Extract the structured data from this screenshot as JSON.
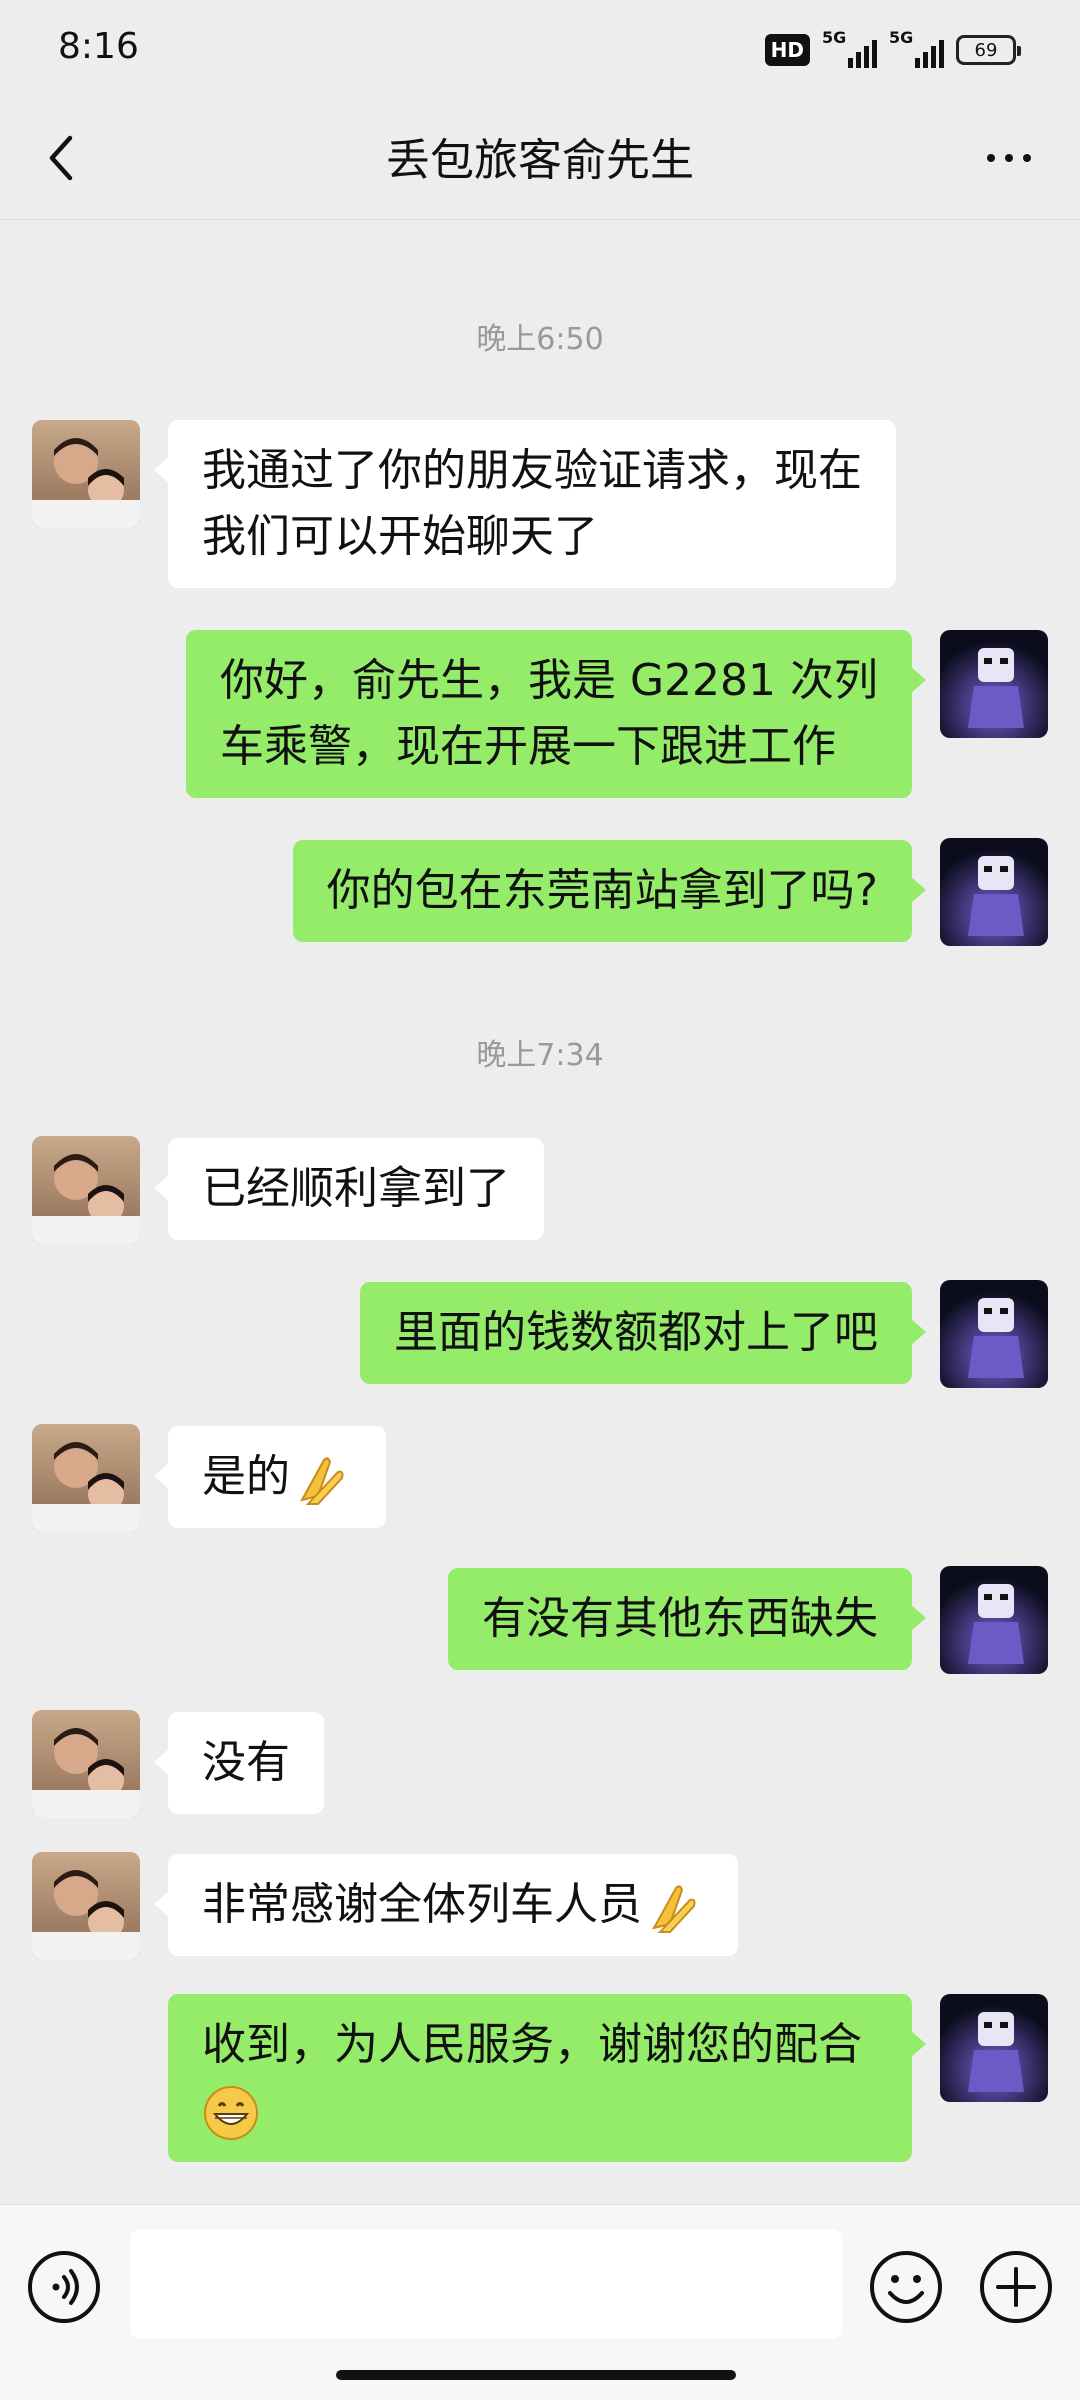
{
  "status_bar": {
    "time": "8:16",
    "hd_badge": "HD",
    "network1": "5G",
    "network2": "5G",
    "battery": "69"
  },
  "header": {
    "title": "丢包旅客俞先生"
  },
  "timestamps": [
    "晚上6:50",
    "晚上7:34"
  ],
  "messages": [
    {
      "side": "recv",
      "lines": [
        "我通过了你的朋友验证请求，现在",
        "我们可以开始聊天了"
      ]
    },
    {
      "side": "sent",
      "lines": [
        "你好，俞先生，我是 G2281 次列",
        "车乘警，现在开展一下跟进工作"
      ]
    },
    {
      "side": "sent",
      "lines": [
        "你的包在东莞南站拿到了吗?"
      ]
    },
    {
      "side": "recv",
      "lines": [
        "已经顺利拿到了"
      ]
    },
    {
      "side": "sent",
      "lines": [
        "里面的钱数额都对上了吧"
      ]
    },
    {
      "side": "recv",
      "lines": [
        "是的"
      ],
      "emoji": "pray-emoji"
    },
    {
      "side": "sent",
      "lines": [
        "有没有其他东西缺失"
      ]
    },
    {
      "side": "recv",
      "lines": [
        "没有"
      ]
    },
    {
      "side": "recv",
      "lines": [
        "非常感谢全体列车人员"
      ],
      "emoji": "pray-emoji"
    },
    {
      "side": "sent",
      "lines": [
        "收到，为人民服务，谢谢您的配合"
      ],
      "emoji": "grin-emoji"
    }
  ],
  "colors": {
    "background": "#ededed",
    "sent_bubble": "#95ec69",
    "recv_bubble": "#ffffff",
    "timestamp": "#999999"
  },
  "icons": {
    "back": "chevron-left-icon",
    "more": "more-dots-icon",
    "voice": "voice-icon",
    "emoji": "emoji-icon",
    "plus": "plus-icon"
  }
}
